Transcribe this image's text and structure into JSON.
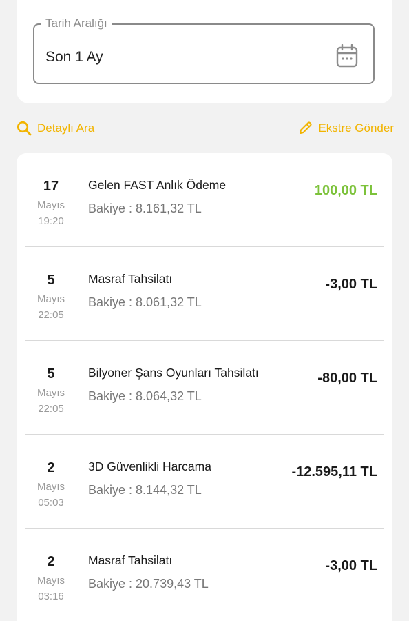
{
  "filter": {
    "date_range_label": "Tarih Aralığı",
    "date_range_value": "Son 1 Ay",
    "calendar_icon": "calendar-icon"
  },
  "actions": {
    "detailed_search": "Detaylı Ara",
    "send_statement": "Ekstre Gönder",
    "search_icon": "search-icon",
    "pencil_icon": "pencil-icon",
    "accent_color": "#f2b400"
  },
  "transactions": [
    {
      "day": "17",
      "month": "Mayıs",
      "time": "19:20",
      "title": "Gelen FAST Anlık Ödeme",
      "balance": "Bakiye : 8.161,32 TL",
      "amount": "100,00 TL",
      "amount_color": "#7cc23a"
    },
    {
      "day": "5",
      "month": "Mayıs",
      "time": "22:05",
      "title": "Masraf Tahsilatı",
      "balance": "Bakiye : 8.061,32 TL",
      "amount": "-3,00 TL",
      "amount_color": "#1a1a1a"
    },
    {
      "day": "5",
      "month": "Mayıs",
      "time": "22:05",
      "title": "Bilyoner Şans Oyunları Tahsilatı",
      "balance": "Bakiye : 8.064,32 TL",
      "amount": "-80,00 TL",
      "amount_color": "#1a1a1a"
    },
    {
      "day": "2",
      "month": "Mayıs",
      "time": "05:03",
      "title": "3D Güvenlikli Harcama",
      "balance": "Bakiye : 8.144,32 TL",
      "amount": "-12.595,11 TL",
      "amount_color": "#1a1a1a"
    },
    {
      "day": "2",
      "month": "Mayıs",
      "time": "03:16",
      "title": "Masraf Tahsilatı",
      "balance": "Bakiye : 20.739,43 TL",
      "amount": "-3,00 TL",
      "amount_color": "#1a1a1a"
    }
  ]
}
